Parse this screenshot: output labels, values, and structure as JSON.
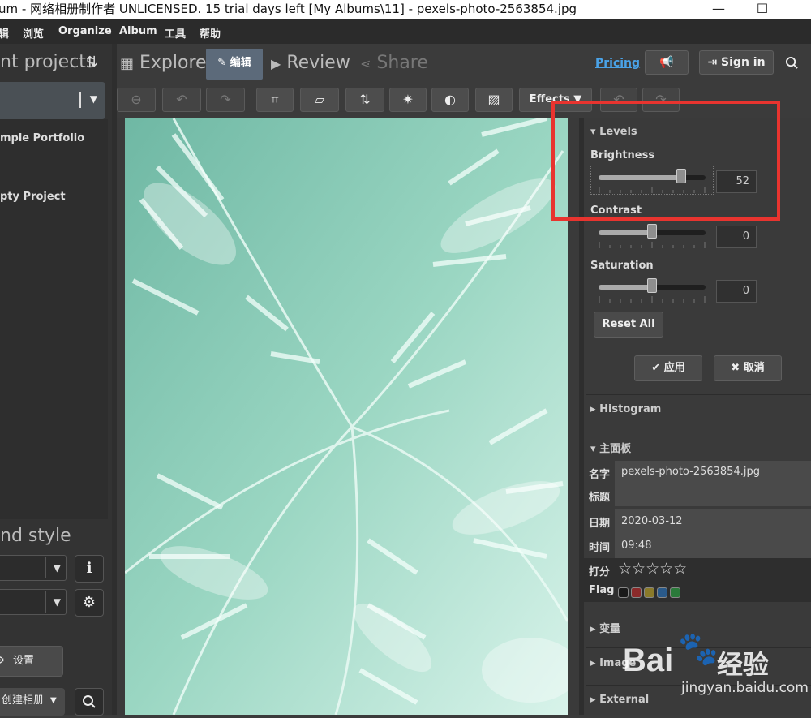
{
  "titlebar": {
    "title": "um - 网络相册制作者 UNLICENSED. 15 trial days left [My Albums\\11] - pexels-photo-2563854.jpg"
  },
  "menu": [
    "辑",
    "浏览",
    "Organize",
    "Album",
    "工具",
    "帮助"
  ],
  "sidebar": {
    "projects_heading": "nt projects",
    "projects": [
      "mple Portfolio",
      "pty Project"
    ],
    "style_heading": "nd style",
    "settings_label": "设置",
    "create_album_label": "创建相册"
  },
  "tabs": {
    "explore": "Explore",
    "edit": "编辑",
    "review": "Review",
    "share": "Share"
  },
  "header": {
    "pricing": "Pricing",
    "sign_in": "Sign in"
  },
  "toolbar": {
    "effects": "Effects"
  },
  "levels": {
    "heading": "Levels",
    "brightness_label": "Brightness",
    "brightness": "52",
    "contrast_label": "Contrast",
    "contrast": "0",
    "saturation_label": "Saturation",
    "saturation": "0",
    "reset_label": "Reset All",
    "apply_label": "应用",
    "cancel_label": "取消"
  },
  "sections": {
    "histogram": "Histogram",
    "main_panel": "主面板",
    "transform": "变量",
    "image": "Image",
    "external": "External"
  },
  "metadata": {
    "name_label": "名字",
    "name_value": "pexels-photo-2563854.jpg",
    "title_label": "标题",
    "title_value": "",
    "date_label": "日期",
    "date_value": "2020-03-12",
    "time_label": "时间",
    "time_value": "09:48",
    "rating_label": "打分",
    "rating_value": "☆☆☆☆☆",
    "flag_label": "Flag"
  },
  "watermark": {
    "brand": "Bai",
    "brand2": "经验",
    "url": "jingyan.baidu.com"
  },
  "colors": {
    "accent": "#4aa3e8",
    "highlight": "#e8342f",
    "active_tab": "#5c6a7a",
    "flags": [
      "#1a1a1a",
      "#8b2a2a",
      "#8a7a2a",
      "#2a5a8a",
      "#2a7a3a"
    ]
  }
}
